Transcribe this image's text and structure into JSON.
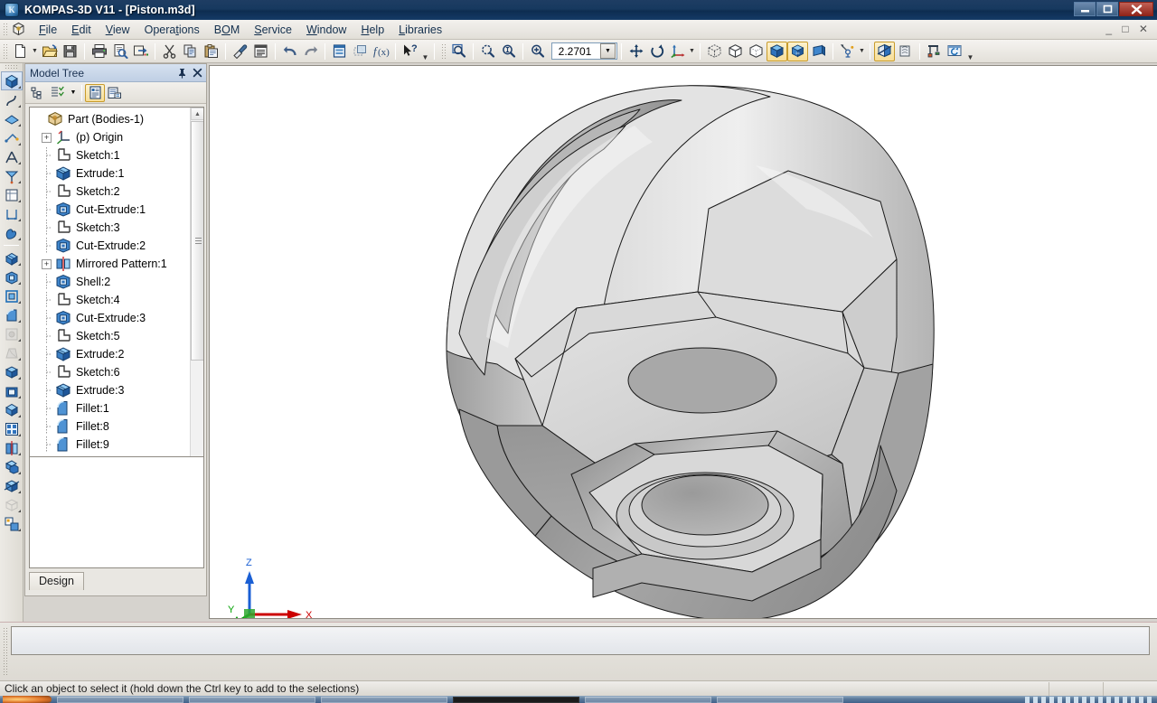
{
  "window": {
    "app_icon": "kompas-logo-icon",
    "title": "KOMPAS-3D V11 - [Piston.m3d]",
    "controls": {
      "minimize": "—",
      "maximize": "❐",
      "close": "✕"
    },
    "mdi_controls": "_ □ ✕"
  },
  "menubar": {
    "app_button_icon": "document-cube-icon",
    "items": [
      {
        "label": "File",
        "accel": "F"
      },
      {
        "label": "Edit",
        "accel": "E"
      },
      {
        "label": "View",
        "accel": "V"
      },
      {
        "label": "Operations",
        "accel": "t"
      },
      {
        "label": "BOM",
        "accel": "O"
      },
      {
        "label": "Service",
        "accel": "S"
      },
      {
        "label": "Window",
        "accel": "W"
      },
      {
        "label": "Help",
        "accel": "H"
      },
      {
        "label": "Libraries",
        "accel": "L"
      }
    ]
  },
  "toolbar": {
    "groups": [
      {
        "name": "file",
        "buttons": [
          {
            "icon": "new-document-icon",
            "label": "New"
          },
          {
            "icon": "new-dropdown-arrow",
            "label": "New (list)"
          },
          {
            "icon": "open-folder-icon",
            "label": "Open"
          },
          {
            "icon": "save-disk-icon",
            "label": "Save"
          }
        ]
      },
      {
        "name": "print",
        "buttons": [
          {
            "icon": "print-icon",
            "label": "Print"
          },
          {
            "icon": "print-preview-icon",
            "label": "Print preview"
          },
          {
            "icon": "send-to-icon",
            "label": "Send"
          }
        ]
      },
      {
        "name": "clipboard",
        "buttons": [
          {
            "icon": "scissors-cut-icon",
            "label": "Cut"
          },
          {
            "icon": "copy-icon",
            "label": "Copy"
          },
          {
            "icon": "paste-icon",
            "label": "Paste"
          }
        ]
      },
      {
        "name": "format",
        "buttons": [
          {
            "icon": "format-painter-brush-icon",
            "label": "Copy properties"
          },
          {
            "icon": "properties-list-icon",
            "label": "Properties"
          }
        ]
      },
      {
        "name": "undo",
        "buttons": [
          {
            "icon": "undo-arrow-icon",
            "label": "Undo"
          },
          {
            "icon": "redo-arrow-icon",
            "label": "Redo"
          }
        ]
      },
      {
        "name": "manager",
        "buttons": [
          {
            "icon": "document-manager-icon",
            "label": "Document manager"
          },
          {
            "icon": "layers-icon",
            "label": "Layers"
          },
          {
            "icon": "variables-fx-icon",
            "label": "Variables f(x)"
          }
        ]
      },
      {
        "name": "help-pointer",
        "buttons": [
          {
            "icon": "pointer-help-icon",
            "label": "What's this?"
          }
        ]
      },
      {
        "name": "zoom-tools",
        "buttons": [
          {
            "icon": "zoom-window-icon",
            "label": "Zoom window"
          },
          {
            "icon": "zoom-selection-icon",
            "label": "Zoom to selection"
          },
          {
            "icon": "zoom-fit-icon",
            "label": "Zoom to fit"
          },
          {
            "icon": "zoom-in-icon",
            "label": "Zoom in"
          }
        ]
      },
      {
        "name": "navigate",
        "buttons": [
          {
            "icon": "pan-move-icon",
            "label": "Pan"
          },
          {
            "icon": "rotate-icon",
            "label": "Rotate"
          },
          {
            "icon": "orientation-axes-icon",
            "label": "Orientation"
          },
          {
            "icon": "orientation-dropdown-arrow",
            "label": "Orientation list"
          }
        ]
      },
      {
        "name": "display-mode",
        "buttons": [
          {
            "icon": "wireframe-icon",
            "label": "Wireframe"
          },
          {
            "icon": "hidden-lines-off-icon",
            "label": "Hidden lines invisible"
          },
          {
            "icon": "hidden-lines-thin-icon",
            "label": "Hidden lines thin"
          },
          {
            "icon": "shaded-with-edges-icon",
            "label": "Shaded with edges",
            "active": true
          },
          {
            "icon": "shaded-perspective-icon",
            "label": "Shaded",
            "active": true
          },
          {
            "icon": "shaded-solid-icon",
            "label": "Solid"
          }
        ]
      },
      {
        "name": "lighting",
        "buttons": [
          {
            "icon": "light-source-icon",
            "label": "Light sources"
          },
          {
            "icon": "light-dropdown-arrow",
            "label": "Light list"
          }
        ]
      },
      {
        "name": "section",
        "buttons": [
          {
            "icon": "section-view-icon",
            "label": "Section view",
            "active": true
          },
          {
            "icon": "cutaway-icon",
            "label": "Cutaway"
          }
        ]
      },
      {
        "name": "rebuild",
        "buttons": [
          {
            "icon": "rebuild-model-icon",
            "label": "Rebuild model"
          },
          {
            "icon": "refresh-view-icon",
            "label": "Refresh view"
          }
        ]
      }
    ],
    "zoom": {
      "value": "2.2701",
      "dropdown_icon": "chevron-down-icon"
    },
    "overflow_icon": "toolbar-overflow-icon"
  },
  "left_toolbar": {
    "expand_icon": "expand-panel-icon",
    "accent_color": "#35b0c8",
    "groups": [
      [
        {
          "icon": "pointer-cube-icon",
          "label": "Edit part",
          "active": true
        },
        {
          "icon": "spline-curve-icon",
          "label": "Spatial curves"
        },
        {
          "icon": "plane-surface-icon",
          "label": "Surfaces"
        },
        {
          "icon": "point-array-icon",
          "label": "Points"
        },
        {
          "icon": "axis-icon",
          "label": "Axes"
        },
        {
          "icon": "plane-icon",
          "label": "Planes"
        },
        {
          "icon": "sketch-icon",
          "label": "Sketch"
        },
        {
          "icon": "dimension-icon",
          "label": "Dimensions"
        },
        {
          "icon": "shell-hand-icon",
          "label": "Shell"
        }
      ],
      [
        {
          "icon": "extrude-boss-icon",
          "label": "Extrude"
        },
        {
          "icon": "cut-extrude-icon",
          "label": "Cut extrude"
        },
        {
          "icon": "cut-frame-icon",
          "label": "Cut"
        },
        {
          "icon": "fillet-icon",
          "label": "Fillet"
        },
        {
          "icon": "hole-icon",
          "label": "Hole",
          "disabled": true
        },
        {
          "icon": "draft-icon",
          "label": "Draft",
          "disabled": true
        },
        {
          "icon": "rib-icon",
          "label": "Rib"
        },
        {
          "icon": "shell-icon",
          "label": "Shell"
        },
        {
          "icon": "pattern-diamond-icon",
          "label": "Pattern"
        },
        {
          "icon": "pattern-grid-icon",
          "label": "Array"
        },
        {
          "icon": "mirror-pattern-icon",
          "label": "Mirror"
        },
        {
          "icon": "boolean-union-icon",
          "label": "Boolean"
        },
        {
          "icon": "body-cut-icon",
          "label": "Body cut"
        },
        {
          "icon": "scale-body-icon",
          "label": "Scale",
          "disabled": true
        },
        {
          "icon": "assembly-components-icon",
          "label": "Components"
        }
      ]
    ]
  },
  "tree_panel": {
    "title": "Model Tree",
    "pin_icon": "pin-icon",
    "close_icon": "close-icon",
    "toolbar": [
      {
        "icon": "tree-structure-icon",
        "label": "Tree structure"
      },
      {
        "icon": "tree-filter-icon",
        "label": "Filter"
      },
      {
        "icon": "tree-filter-dropdown-arrow",
        "label": "Filter list"
      },
      {
        "icon": "tree-show-panel-icon",
        "label": "Show tree panel",
        "active": true
      },
      {
        "icon": "tree-properties-icon",
        "label": "Tree properties"
      }
    ],
    "scrollbar": {
      "up_arrow_icon": "scroll-up-arrow-icon",
      "down_arrow_icon": "scroll-down-arrow-icon",
      "grip_icon": "scroll-grip-icon"
    },
    "items": [
      {
        "label": "Part (Bodies-1)",
        "icon": "part-body-icon",
        "indent": 0,
        "expander": ""
      },
      {
        "label": "(p) Origin",
        "icon": "origin-axes-icon",
        "indent": 1,
        "expander": "+"
      },
      {
        "label": "Sketch:1",
        "icon": "sketch-icon",
        "indent": 1,
        "expander": ""
      },
      {
        "label": "Extrude:1",
        "icon": "extrude-icon",
        "indent": 1,
        "expander": ""
      },
      {
        "label": "Sketch:2",
        "icon": "sketch-icon",
        "indent": 1,
        "expander": ""
      },
      {
        "label": "Cut-Extrude:1",
        "icon": "cut-extrude-icon",
        "indent": 1,
        "expander": ""
      },
      {
        "label": "Sketch:3",
        "icon": "sketch-icon",
        "indent": 1,
        "expander": ""
      },
      {
        "label": "Cut-Extrude:2",
        "icon": "cut-extrude-icon",
        "indent": 1,
        "expander": ""
      },
      {
        "label": "Mirrored Pattern:1",
        "icon": "mirror-pattern-icon",
        "indent": 1,
        "expander": "+"
      },
      {
        "label": "Shell:2",
        "icon": "cut-extrude-icon",
        "indent": 1,
        "expander": ""
      },
      {
        "label": "Sketch:4",
        "icon": "sketch-icon",
        "indent": 1,
        "expander": ""
      },
      {
        "label": "Cut-Extrude:3",
        "icon": "cut-extrude-icon",
        "indent": 1,
        "expander": ""
      },
      {
        "label": "Sketch:5",
        "icon": "sketch-icon",
        "indent": 1,
        "expander": ""
      },
      {
        "label": "Extrude:2",
        "icon": "extrude-icon",
        "indent": 1,
        "expander": ""
      },
      {
        "label": "Sketch:6",
        "icon": "sketch-icon",
        "indent": 1,
        "expander": ""
      },
      {
        "label": "Extrude:3",
        "icon": "extrude-icon",
        "indent": 1,
        "expander": ""
      },
      {
        "label": "Fillet:1",
        "icon": "fillet-icon",
        "indent": 1,
        "expander": ""
      },
      {
        "label": "Fillet:8",
        "icon": "fillet-icon",
        "indent": 1,
        "expander": ""
      },
      {
        "label": "Fillet:9",
        "icon": "fillet-icon",
        "indent": 1,
        "expander": ""
      }
    ],
    "bottom_tab": "Design"
  },
  "viewport": {
    "model_name": "Piston",
    "background": "#ffffff",
    "axis_triad": {
      "x": {
        "label": "X",
        "color": "#cc0000"
      },
      "y": {
        "label": "Y",
        "color": "#00a000"
      },
      "z": {
        "label": "Z",
        "color": "#1a5fd4"
      }
    }
  },
  "statusbar": {
    "message": "Click an object to select it (hold down the Ctrl key to add to the selections)"
  }
}
